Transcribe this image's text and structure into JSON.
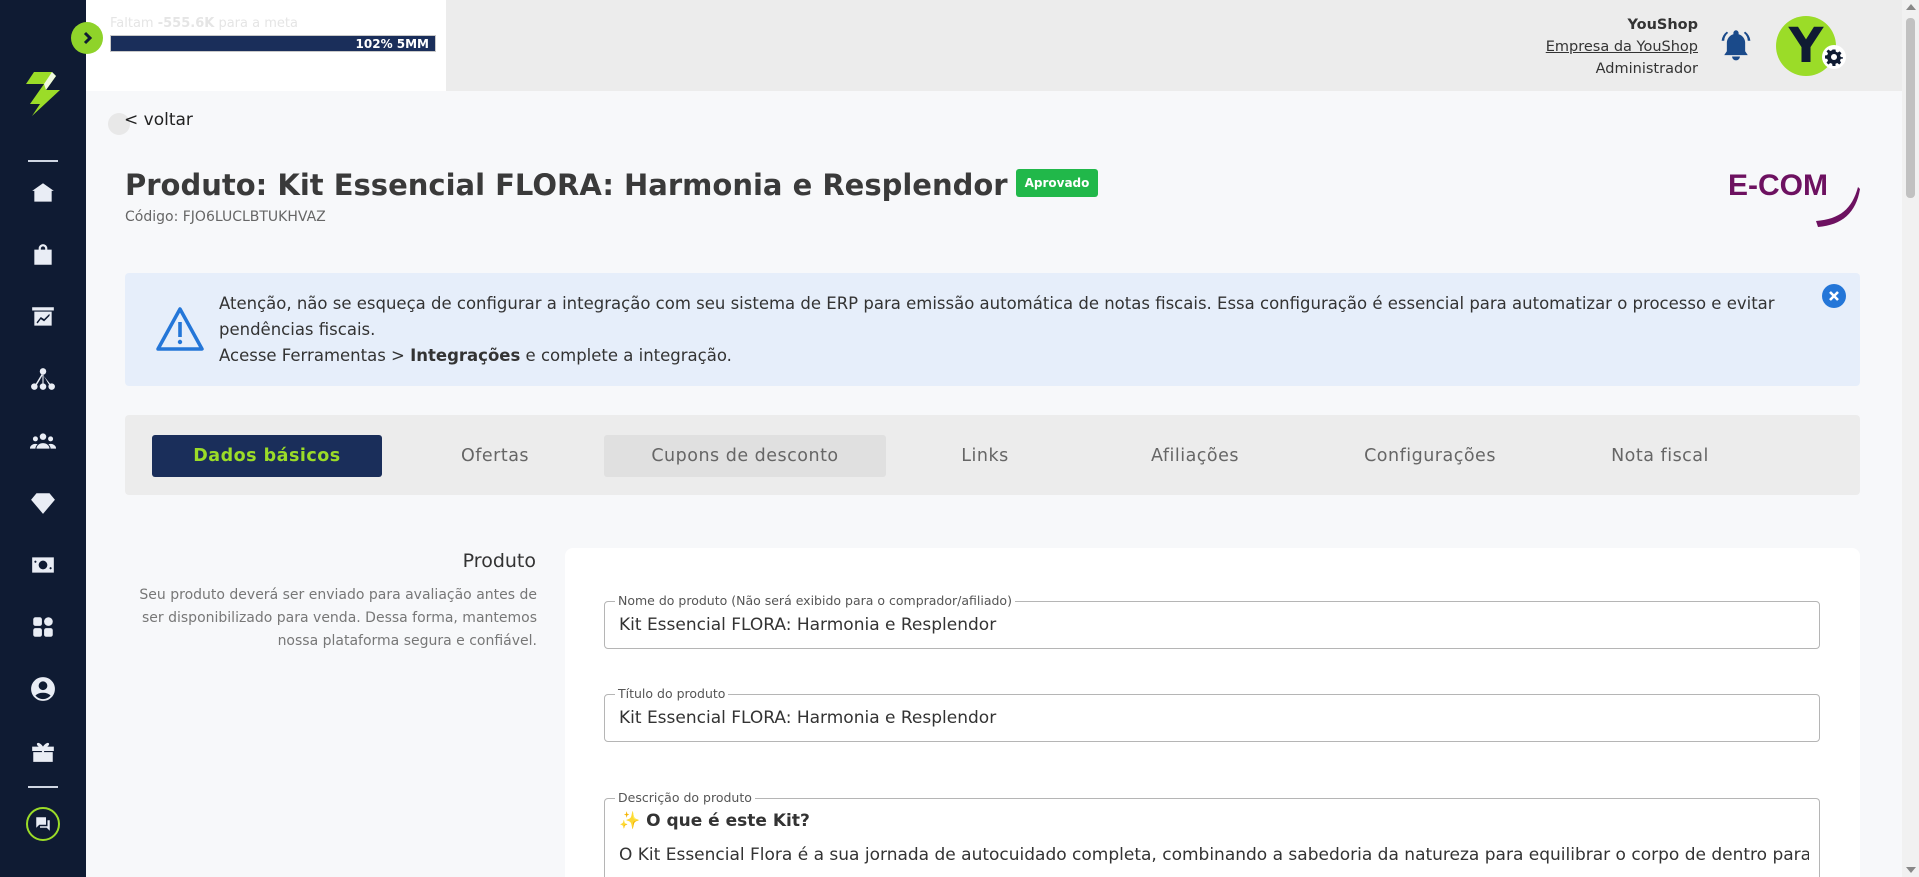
{
  "goal": {
    "text_prefix": "Faltam ",
    "amount": "-555.6K",
    "text_suffix": " para a meta",
    "bar_label": "102% 5MM"
  },
  "user": {
    "name": "YouShop",
    "company": "Empresa da YouShop",
    "role": "Administrador",
    "avatar_letter": "Y"
  },
  "page": {
    "back_label": "< voltar",
    "title": "Produto: Kit Essencial FLORA: Harmonia e Resplendor",
    "status_badge": "Aprovado",
    "code": "Código: FJO6LUCLBTUKHVAZ",
    "brand_text": "E-COM"
  },
  "alert": {
    "line1": "Atenção, não se esqueça de configurar a integração com seu sistema de ERP para emissão automática de notas fiscais. Essa configuração é essencial para automatizar o processo e evitar pendências fiscais.",
    "line2_prefix": "Acesse Ferramentas > ",
    "line2_bold": "Integrações",
    "line2_suffix": " e complete a integração."
  },
  "tabs": [
    {
      "label": "Dados básicos",
      "active": true
    },
    {
      "label": "Ofertas",
      "active": false
    },
    {
      "label": "Cupons de desconto",
      "active": false
    },
    {
      "label": "Links",
      "active": false
    },
    {
      "label": "Afiliações",
      "active": false
    },
    {
      "label": "Configurações",
      "active": false
    },
    {
      "label": "Nota fiscal",
      "active": false
    }
  ],
  "section": {
    "title": "Produto",
    "description": "Seu produto deverá ser enviado para avaliação antes de ser disponibilizado para venda. Dessa forma, mantemos nossa plataforma segura e confiável."
  },
  "form": {
    "name_label": "Nome do produto (Não será exibido para o comprador/afiliado)",
    "name_value": "Kit Essencial FLORA: Harmonia e Resplendor",
    "title_label": "Título do produto",
    "title_value": "Kit Essencial FLORA: Harmonia e Resplendor",
    "desc_label": "Descrição do produto",
    "desc_heading": "✨ O que é este Kit?",
    "desc_body": "O Kit Essencial Flora é a sua jornada de autocuidado completa, combinando a sabedoria da natureza para equilibrar o corpo de dentro para fora e"
  },
  "sidebar_icons": [
    "home-icon",
    "bag-icon",
    "chart-board-icon",
    "network-icon",
    "users-icon",
    "diamond-icon",
    "cash-icon",
    "apps-icon",
    "profile-icon",
    "gift-icon",
    "chat-icon"
  ],
  "colors": {
    "sidebar": "#0f1b33",
    "accent": "#9bdc28",
    "active_tab": "#1a2e5a",
    "badge": "#21b84a",
    "alert_bg": "#e6eefa",
    "brand": "#6d1160"
  }
}
